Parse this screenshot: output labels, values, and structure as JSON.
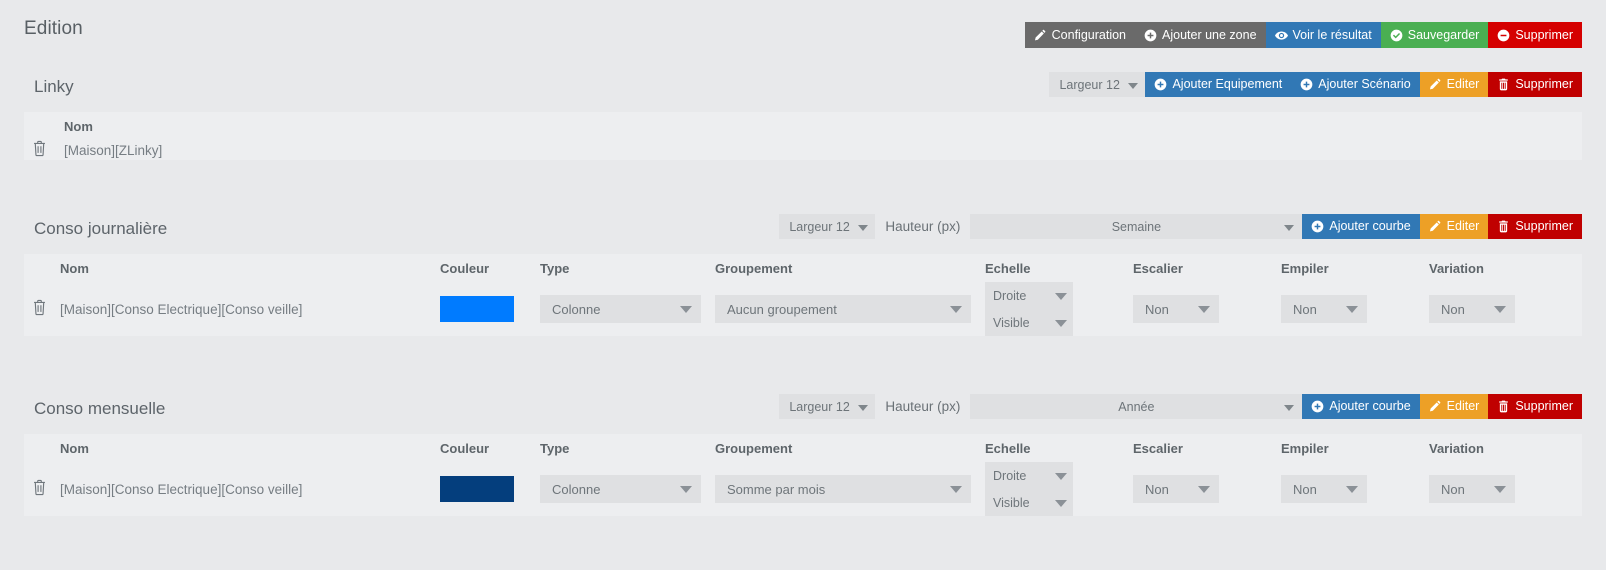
{
  "header": {
    "title": "Edition",
    "actions": [
      {
        "label": "Configuration",
        "icon": "pencil-icon",
        "style": "grey"
      },
      {
        "label": "Ajouter une zone",
        "icon": "plus-circle-icon",
        "style": "grey"
      },
      {
        "label": "Voir le résultat",
        "icon": "eye-icon",
        "style": "blue"
      },
      {
        "label": "Sauvegarder",
        "icon": "check-circle-icon",
        "style": "green"
      },
      {
        "label": "Supprimer",
        "icon": "minus-circle-icon",
        "style": "red"
      }
    ]
  },
  "zones": [
    {
      "title": "Linky",
      "width_select": "Largeur 12",
      "has_period": false,
      "actions": [
        {
          "label": "Ajouter Equipement",
          "icon": "plus-circle-icon",
          "style": "blue"
        },
        {
          "label": "Ajouter Scénario",
          "icon": "plus-circle-icon",
          "style": "blue"
        },
        {
          "label": "Editer",
          "icon": "pencil-icon",
          "style": "orange"
        },
        {
          "label": "Supprimer",
          "icon": "trash-icon",
          "style": "darkred"
        }
      ],
      "columns": [
        "Nom"
      ],
      "rows": [
        {
          "delete_icon": "trash-icon",
          "name": "[Maison][ZLinky]"
        }
      ]
    },
    {
      "title": "Conso journalière",
      "width_select": "Largeur 12",
      "has_period": true,
      "height_label": "Hauteur (px)",
      "height_value": "",
      "period_value": "Semaine",
      "actions": [
        {
          "label": "Ajouter courbe",
          "icon": "plus-circle-icon",
          "style": "blue"
        },
        {
          "label": "Editer",
          "icon": "pencil-icon",
          "style": "orange"
        },
        {
          "label": "Supprimer",
          "icon": "trash-icon",
          "style": "darkred"
        }
      ],
      "columns": [
        "Nom",
        "Couleur",
        "Type",
        "Groupement",
        "Echelle",
        "Escalier",
        "Empiler",
        "Variation"
      ],
      "rows": [
        {
          "delete_icon": "trash-icon",
          "name": "[Maison][Conso Electrique][Conso veille]",
          "color": "#007bff",
          "type": "Colonne",
          "groupement": "Aucun groupement",
          "echelle_side": "Droite",
          "echelle_visible": "Visible",
          "escalier": "Non",
          "empiler": "Non",
          "variation": "Non"
        }
      ]
    },
    {
      "title": "Conso mensuelle",
      "width_select": "Largeur 12",
      "has_period": true,
      "height_label": "Hauteur (px)",
      "height_value": "",
      "period_value": "Année",
      "actions": [
        {
          "label": "Ajouter courbe",
          "icon": "plus-circle-icon",
          "style": "blue"
        },
        {
          "label": "Editer",
          "icon": "pencil-icon",
          "style": "orange"
        },
        {
          "label": "Supprimer",
          "icon": "trash-icon",
          "style": "darkred"
        }
      ],
      "columns": [
        "Nom",
        "Couleur",
        "Type",
        "Groupement",
        "Echelle",
        "Escalier",
        "Empiler",
        "Variation"
      ],
      "rows": [
        {
          "delete_icon": "trash-icon",
          "name": "[Maison][Conso Electrique][Conso veille]",
          "color": "#043e7d",
          "type": "Colonne",
          "groupement": "Somme par mois",
          "echelle_side": "Droite",
          "echelle_visible": "Visible",
          "escalier": "Non",
          "empiler": "Non",
          "variation": "Non"
        }
      ]
    }
  ],
  "theme": {
    "background": "#e8e9eb",
    "panel": "#edeef0",
    "control": "#dfe0e2",
    "accent_blue": "#3178b5",
    "accent_green": "#4aaf52",
    "accent_red": "#d50000",
    "accent_orange": "#eda026"
  }
}
